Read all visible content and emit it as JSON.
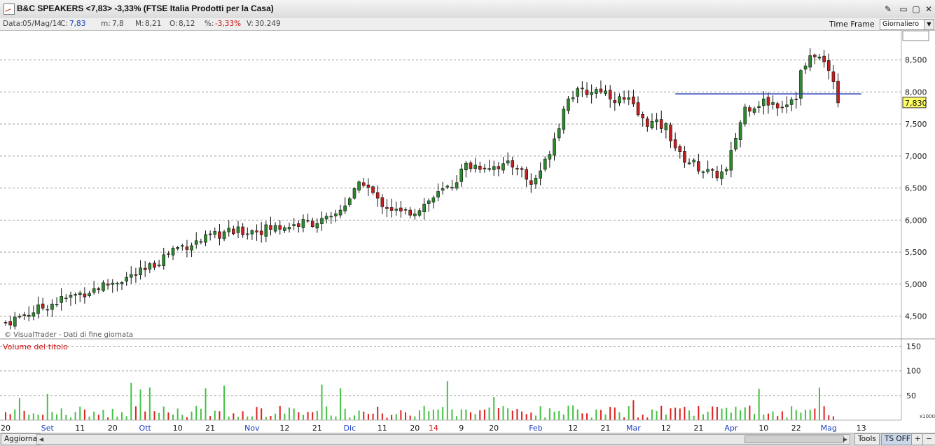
{
  "window": {
    "title": "B&C SPEAKERS <7,83> -3,33%  (FTSE Italia Prodotti per la Casa)",
    "buttons": {
      "tool": "✎",
      "min": "▭",
      "max": "▢",
      "close": "✕"
    }
  },
  "infobar": {
    "data_label": "Data:",
    "data_value": "05/Mag/14",
    "close_label": "C:",
    "close_value": "7,83",
    "min_label": "m:",
    "min_value": "7,8",
    "max_label": "M:",
    "max_value": "8,21",
    "open_label": "O:",
    "open_value": "8,12",
    "pct_label": "%:",
    "pct_value": "-3,33%",
    "vol_label": "V:",
    "vol_value": "30.249",
    "time_frame_label": "Time Frame",
    "time_frame_value": "Giornaliero"
  },
  "chart_data": {
    "type": "candlestick",
    "watermark": "© VisualTrader - Dati di fine giornata",
    "price_axis": {
      "ticks": [
        "8,500",
        "8,000",
        "7,500",
        "7,000",
        "6,500",
        "6,000",
        "5,500",
        "5,000",
        "4,500"
      ],
      "ylim": [
        4.2,
        8.9
      ]
    },
    "last_price_label": "7,830",
    "last_price": 7.83,
    "support_line": {
      "price": 7.97,
      "from_index": 144,
      "to_index": 184
    },
    "volume_panel": {
      "title": "Volume del titolo",
      "ticks": [
        "150",
        "100",
        "50"
      ],
      "unit": "x1000",
      "last_volume_label": "30.249",
      "last_volume": 30.249
    },
    "x_ticks": [
      {
        "label": "20",
        "i": 0,
        "color": "#111111"
      },
      {
        "label": "Set",
        "i": 9,
        "color": "#1a3fbf"
      },
      {
        "label": "11",
        "i": 16,
        "color": "#111111"
      },
      {
        "label": "20",
        "i": 23,
        "color": "#111111"
      },
      {
        "label": "Ott",
        "i": 30,
        "color": "#1a3fbf"
      },
      {
        "label": "10",
        "i": 37,
        "color": "#111111"
      },
      {
        "label": "21",
        "i": 44,
        "color": "#111111"
      },
      {
        "label": "Nov",
        "i": 53,
        "color": "#1a3fbf"
      },
      {
        "label": "12",
        "i": 60,
        "color": "#111111"
      },
      {
        "label": "21",
        "i": 67,
        "color": "#111111"
      },
      {
        "label": "Dic",
        "i": 74,
        "color": "#1a3fbf"
      },
      {
        "label": "11",
        "i": 81,
        "color": "#111111"
      },
      {
        "label": "20",
        "i": 88,
        "color": "#111111"
      },
      {
        "label": "14",
        "i": 92,
        "color": "#d01010"
      },
      {
        "label": "9",
        "i": 98,
        "color": "#111111"
      },
      {
        "label": "20",
        "i": 105,
        "color": "#111111"
      },
      {
        "label": "Feb",
        "i": 114,
        "color": "#1a3fbf"
      },
      {
        "label": "12",
        "i": 122,
        "color": "#111111"
      },
      {
        "label": "21",
        "i": 129,
        "color": "#111111"
      },
      {
        "label": "Mar",
        "i": 135,
        "color": "#1a3fbf"
      },
      {
        "label": "12",
        "i": 142,
        "color": "#111111"
      },
      {
        "label": "21",
        "i": 149,
        "color": "#111111"
      },
      {
        "label": "Apr",
        "i": 156,
        "color": "#1a3fbf"
      },
      {
        "label": "10",
        "i": 163,
        "color": "#111111"
      },
      {
        "label": "22",
        "i": 170,
        "color": "#111111"
      },
      {
        "label": "Mag",
        "i": 177,
        "color": "#1a3fbf"
      },
      {
        "label": "13",
        "i": 184,
        "color": "#111111"
      }
    ],
    "path_points": [
      [
        0,
        4.4
      ],
      [
        10,
        4.7
      ],
      [
        22,
        5.0
      ],
      [
        30,
        5.2
      ],
      [
        36,
        5.55
      ],
      [
        43,
        5.7
      ],
      [
        47,
        5.8
      ],
      [
        55,
        5.85
      ],
      [
        64,
        5.95
      ],
      [
        70,
        6.0
      ],
      [
        74,
        6.35
      ],
      [
        77,
        6.6
      ],
      [
        80,
        6.3
      ],
      [
        85,
        6.1
      ],
      [
        88,
        6.15
      ],
      [
        92,
        6.35
      ],
      [
        96,
        6.55
      ],
      [
        99,
        6.85
      ],
      [
        104,
        6.85
      ],
      [
        110,
        6.85
      ],
      [
        113,
        6.55
      ],
      [
        116,
        6.9
      ],
      [
        119,
        7.5
      ],
      [
        121,
        7.95
      ],
      [
        125,
        8.0
      ],
      [
        128,
        8.05
      ],
      [
        131,
        7.9
      ],
      [
        134,
        7.85
      ],
      [
        137,
        7.55
      ],
      [
        142,
        7.45
      ],
      [
        145,
        7.0
      ],
      [
        152,
        6.7
      ],
      [
        155,
        6.75
      ],
      [
        157,
        7.3
      ],
      [
        159,
        7.75
      ],
      [
        163,
        7.85
      ],
      [
        167,
        7.8
      ],
      [
        170,
        7.95
      ],
      [
        171,
        8.3
      ],
      [
        174,
        8.6
      ],
      [
        176,
        8.45
      ],
      [
        178,
        8.2
      ],
      [
        179,
        7.83
      ]
    ],
    "candles": 180
  },
  "bottombar": {
    "refresh": "Aggiorna",
    "tools": "Tools",
    "tsoff": "TS OFF",
    "plus": "+",
    "minus": "−"
  }
}
